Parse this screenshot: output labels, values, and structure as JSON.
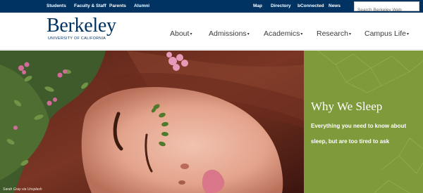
{
  "colors": {
    "brand_navy": "#003262",
    "panel_green": "#7e9a3b",
    "nav_text": "#3b3b3b"
  },
  "topbar": {
    "left_links": [
      "Students",
      "Faculty & Staff",
      "Parents",
      "Alumni"
    ],
    "right_links": [
      "Map",
      "Directory",
      "bConnected",
      "News"
    ],
    "search_placeholder": "Search Berkeley Web"
  },
  "logo": {
    "word": "Berkeley",
    "sub": "UNIVERSITY OF CALIFORNIA"
  },
  "nav": {
    "items": [
      "About",
      "Admissions",
      "Academics",
      "Research",
      "Campus Life"
    ]
  },
  "hero": {
    "title": "Why We Sleep",
    "text": "Everything you need to know about sleep, but are too tired to ask",
    "photo_credit": "Sarah Gray via Unsplash"
  },
  "icons": {
    "caret": "caret-down-icon"
  }
}
